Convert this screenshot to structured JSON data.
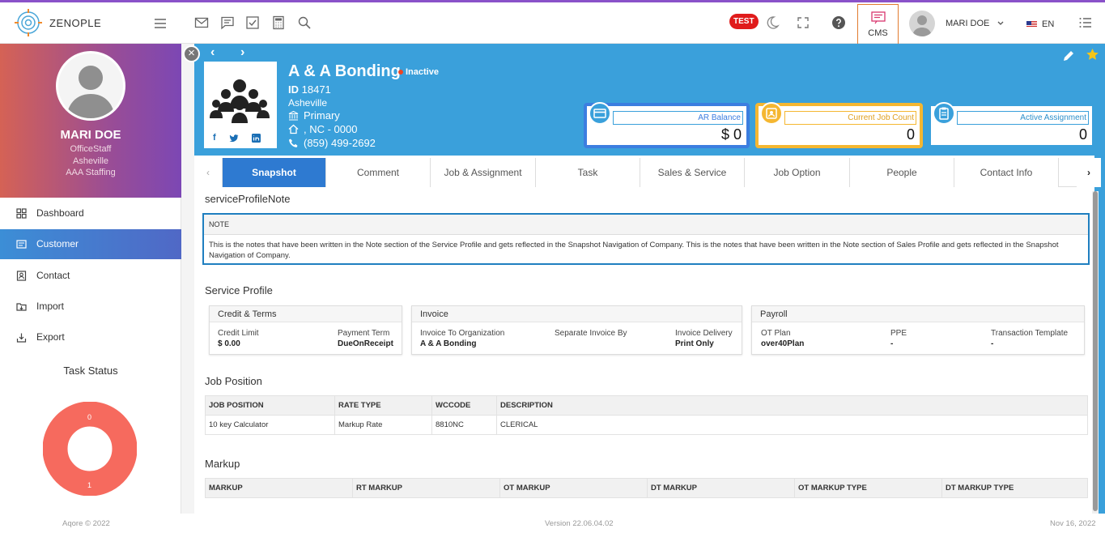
{
  "header": {
    "brand": "ZENOPLE",
    "test_badge": "TEST",
    "cms_label": "CMS",
    "user_name": "MARI DOE",
    "language": "EN",
    "accent_color": "#8a52c9"
  },
  "sidebar": {
    "user": {
      "name": "MARI DOE",
      "role": "OfficeStaff",
      "location": "Asheville",
      "company": "AAA Staffing"
    },
    "nav": [
      {
        "label": "Dashboard",
        "icon": "dashboard-icon"
      },
      {
        "label": "Customer",
        "icon": "customer-icon",
        "active": true
      },
      {
        "label": "Contact",
        "icon": "contact-icon"
      },
      {
        "label": "Import",
        "icon": "import-icon"
      },
      {
        "label": "Export",
        "icon": "export-icon"
      }
    ],
    "task_status": {
      "title": "Task Status",
      "top_value": "0",
      "bottom_value": "1",
      "color": "#f66a5e"
    }
  },
  "company": {
    "name": "A & A Bonding",
    "status": "Inactive",
    "id_label": "ID",
    "id": "18471",
    "city": "Asheville",
    "address_type": "Primary",
    "address": ", NC - 0000",
    "phone": "(859) 499-2692"
  },
  "cards": [
    {
      "title": "AR Balance",
      "value": "$ 0",
      "color": "#3c7ee0"
    },
    {
      "title": "Current Job Count",
      "value": "0",
      "color": "#f5b731"
    },
    {
      "title": "Active Assignment",
      "value": "0",
      "color": "#3aa0db"
    }
  ],
  "tabs": [
    "Snapshot",
    "Comment",
    "Job & Assignment",
    "Task",
    "Sales & Service",
    "Job Option",
    "People",
    "Contact Info"
  ],
  "note": {
    "section_title": "serviceProfileNote",
    "header": "NOTE",
    "text": "This is the notes that have been written in the Note section of the Service Profile and gets reflected in the Snapshot Navigation of Company. This is the notes that have been written in the Note section of Sales Profile and gets reflected in the Snapshot Navigation of Company."
  },
  "service_profile": {
    "title": "Service Profile",
    "credit": {
      "title": "Credit & Terms",
      "limit_label": "Credit Limit",
      "limit": "$ 0.00",
      "term_label": "Payment Term",
      "term": "DueOnReceipt"
    },
    "invoice": {
      "title": "Invoice",
      "org_label": "Invoice To Organization",
      "org": "A & A Bonding",
      "sep_label": "Separate Invoice By",
      "delivery_label": "Invoice Delivery",
      "delivery": "Print Only"
    },
    "payroll": {
      "title": "Payroll",
      "ot_label": "OT Plan",
      "ot": "over40Plan",
      "ppe_label": "PPE",
      "ppe": "-",
      "tt_label": "Transaction Template",
      "tt": "-"
    }
  },
  "job_position": {
    "title": "Job Position",
    "headers": [
      "JOB POSITION",
      "RATE TYPE",
      "WCCODE",
      "DESCRIPTION"
    ],
    "rows": [
      [
        "10 key Calculator",
        "Markup Rate",
        "8810NC",
        "CLERICAL"
      ]
    ]
  },
  "markup": {
    "title": "Markup",
    "headers": [
      "MARKUP",
      "RT MARKUP",
      "OT MARKUP",
      "DT MARKUP",
      "OT MARKUP TYPE",
      "DT MARKUP TYPE"
    ]
  },
  "footer": {
    "copyright": "Aqore © 2022",
    "version": "Version 22.06.04.02",
    "date": "Nov 16, 2022"
  }
}
